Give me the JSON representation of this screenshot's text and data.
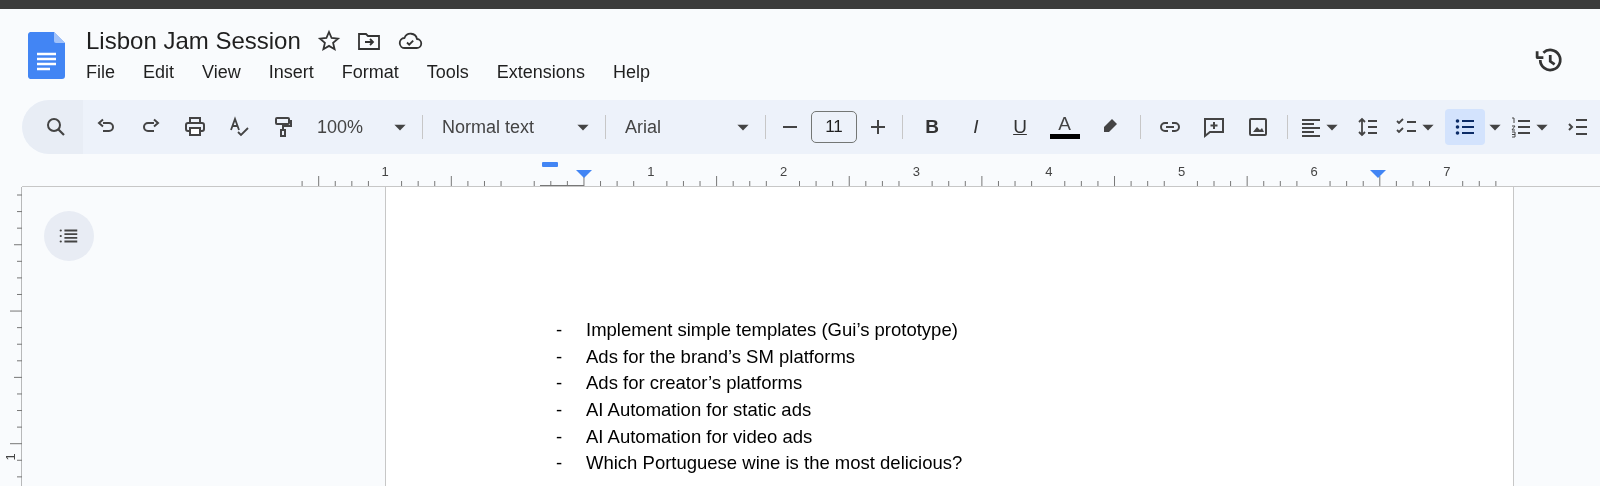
{
  "document": {
    "title": "Lisbon Jam Session"
  },
  "menu": [
    "File",
    "Edit",
    "View",
    "Insert",
    "Format",
    "Tools",
    "Extensions",
    "Help"
  ],
  "toolbar": {
    "zoom": "100%",
    "style": "Normal text",
    "font": "Arial",
    "font_size": "11",
    "formatting": [
      {
        "kind": "bold",
        "label": "B",
        "selected": false
      },
      {
        "kind": "italic",
        "label": "I",
        "selected": false
      },
      {
        "kind": "underline",
        "label": "U",
        "selected": false
      }
    ],
    "text_color": {
      "label": "A"
    },
    "bulleted_list": {
      "selected": true
    }
  },
  "ruler": {
    "labels": [
      "1",
      "1",
      "2",
      "3",
      "4",
      "5",
      "6",
      "7"
    ]
  },
  "vertical_ruler": {
    "labels": [
      "1"
    ]
  },
  "body": {
    "items": [
      {
        "marker": "-",
        "text": "Implement simple templates (Gui’s prototype)"
      },
      {
        "marker": "-",
        "text": "Ads for the brand’s SM platforms"
      },
      {
        "marker": "-",
        "text": "Ads for creator’s platforms"
      },
      {
        "marker": "-",
        "text": "AI Automation for static ads"
      },
      {
        "marker": "-",
        "text": "AI Automation for video ads"
      },
      {
        "marker": "-",
        "text": "Which Portuguese wine is the most delicious?"
      }
    ]
  }
}
